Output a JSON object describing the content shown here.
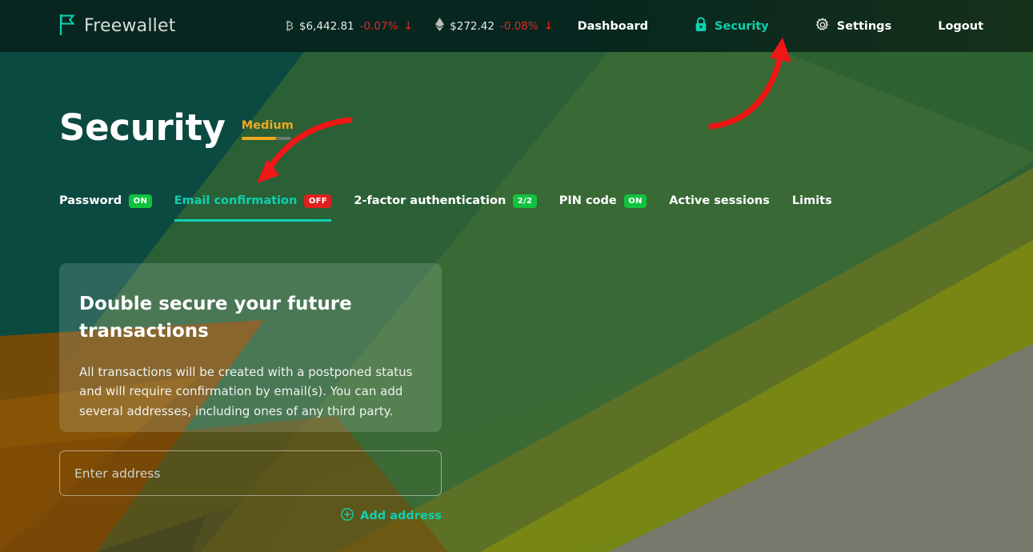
{
  "brand": {
    "name": "Freewallet",
    "logo_icon": "flag-icon",
    "accent": "#0ed0b0"
  },
  "ticker": [
    {
      "icon": "bitcoin-icon",
      "symbol": "₿",
      "price": "$6,442.81",
      "change": "-0.07%",
      "direction": "↓"
    },
    {
      "icon": "ethereum-icon",
      "symbol": "♦",
      "price": "$272.42",
      "change": "-0.08%",
      "direction": "↓"
    }
  ],
  "nav": [
    {
      "label": "Dashboard",
      "icon": null,
      "active": false
    },
    {
      "label": "Security",
      "icon": "lock-icon",
      "active": true
    },
    {
      "label": "Settings",
      "icon": "gear-icon",
      "active": false
    },
    {
      "label": "Logout",
      "icon": null,
      "active": false
    }
  ],
  "page": {
    "title": "Security",
    "level_label": "Medium",
    "level_percent": 70,
    "level_color": "#f0a81d"
  },
  "tabs": [
    {
      "label": "Password",
      "badge": "ON",
      "badge_type": "on",
      "active": false
    },
    {
      "label": "Email confirmation",
      "badge": "OFF",
      "badge_type": "off",
      "active": true
    },
    {
      "label": "2-factor authentication",
      "badge": "2/2",
      "badge_type": "cnt",
      "active": false
    },
    {
      "label": "PIN code",
      "badge": "ON",
      "badge_type": "on",
      "active": false
    },
    {
      "label": "Active sessions",
      "badge": null,
      "badge_type": null,
      "active": false
    },
    {
      "label": "Limits",
      "badge": null,
      "badge_type": null,
      "active": false
    }
  ],
  "card": {
    "title": "Double secure your future transactions",
    "body": "All transactions will be created with a postponed status and will require confirmation by email(s). You can add several addresses, including ones of any third party."
  },
  "form": {
    "address_placeholder": "Enter address",
    "address_value": "",
    "add_label": "Add address",
    "add_icon": "plus-circle-icon"
  },
  "annotations": [
    {
      "name": "arrow-to-security-nav",
      "color": "#f01616"
    },
    {
      "name": "arrow-to-email-confirmation-tab",
      "color": "#f01616"
    }
  ],
  "background": {
    "colors": [
      "#06261f",
      "#0c4a45",
      "#1f5133",
      "#2e6b3c",
      "#4f6b2a",
      "#8c8f0e",
      "#7a4a06",
      "#8d5a08",
      "#7e8073"
    ]
  }
}
